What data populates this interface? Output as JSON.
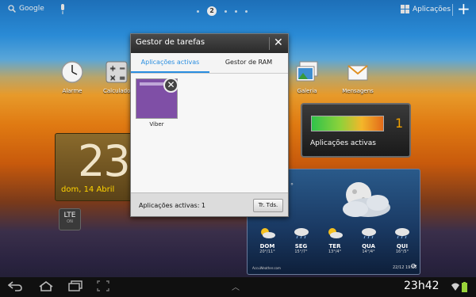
{
  "topbar": {
    "search_label": "Google",
    "page_indicator": "2",
    "apps_label": "Aplicações"
  },
  "home_icons": [
    {
      "label": "Alarme",
      "icon": "clock-icon"
    },
    {
      "label": "Calculado",
      "icon": "calculator-icon"
    },
    {
      "label": "Galeria",
      "icon": "gallery-icon"
    },
    {
      "label": "Mensagens",
      "icon": "messages-icon"
    }
  ],
  "clock_widget": {
    "time": "23",
    "date": "dom, 14 Abril"
  },
  "lte_widget": {
    "label": "LTE",
    "sub": "ON"
  },
  "active_apps_widget": {
    "count": "1",
    "label": "Aplicações activas"
  },
  "weather_widget": {
    "temp_partial": "°",
    "forecast": [
      {
        "day": "DOM",
        "range": "20°/11°"
      },
      {
        "day": "SEG",
        "range": "15°/7°"
      },
      {
        "day": "TER",
        "range": "13°/4°"
      },
      {
        "day": "QUA",
        "range": "14°/4°"
      },
      {
        "day": "QUI",
        "range": "16°/5°"
      }
    ],
    "brand": "AccuWeather.com",
    "updated": "22/12 19:06"
  },
  "task_manager": {
    "title": "Gestor de tarefas",
    "tabs": [
      "Aplicações activas",
      "Gestor de RAM"
    ],
    "apps": [
      {
        "name": "Viber"
      }
    ],
    "footer_label": "Aplicações activas: 1",
    "close_all_label": "Tr. Tds."
  },
  "statusbar": {
    "time": "23h42"
  },
  "colors": {
    "accent": "#2a8ee0",
    "app_purple": "#7f4fa6",
    "clock_date": "#ffd400"
  }
}
